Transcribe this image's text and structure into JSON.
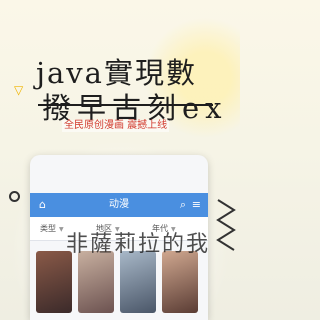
{
  "overlay": {
    "headline": "java實現數",
    "subline": "撥早古刻ex",
    "promo": "全民原创漫画 震撼上线",
    "bottom_text": "非薩莉拉的我"
  },
  "app": {
    "bar_title": "动漫",
    "home_icon": "home-icon",
    "search_icon": "search-icon",
    "menu_icon": "menu-icon"
  },
  "filters": [
    {
      "label": "类型"
    },
    {
      "label": "地区"
    },
    {
      "label": "年代"
    }
  ],
  "colors": {
    "app_bar": "#4a8fe0",
    "promo": "#d23a2e",
    "accent_triangle": "#f0b400"
  }
}
